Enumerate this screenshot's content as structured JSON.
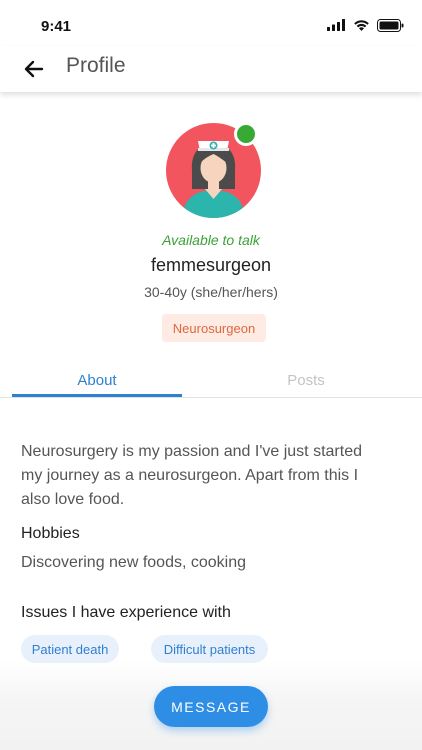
{
  "status_bar": {
    "time": "9:41"
  },
  "app_bar": {
    "title": "Profile"
  },
  "profile": {
    "availability": "Available to talk",
    "username": "femmesurgeon",
    "pronouns": "30-40y (she/her/hers)",
    "profession": "Neurosurgeon",
    "online_color": "#39a935"
  },
  "tabs": [
    {
      "label": "About",
      "active": true
    },
    {
      "label": "Posts",
      "active": false
    }
  ],
  "about": {
    "bio": "Neurosurgery is my passion and I've just started my journey as a neurosurgeon. Apart from this I also love food.",
    "hobbies_heading": "Hobbies",
    "hobbies": "Discovering new foods, cooking",
    "issues_heading": "Issues I have experience with",
    "issues": [
      "Patient death",
      "Difficult patients"
    ]
  },
  "actions": {
    "message_label": "MESSAGE"
  },
  "colors": {
    "accent": "#2f80d1",
    "button": "#2e8ee6",
    "badge_text": "#e0683e",
    "badge_bg": "#fdebe4"
  }
}
